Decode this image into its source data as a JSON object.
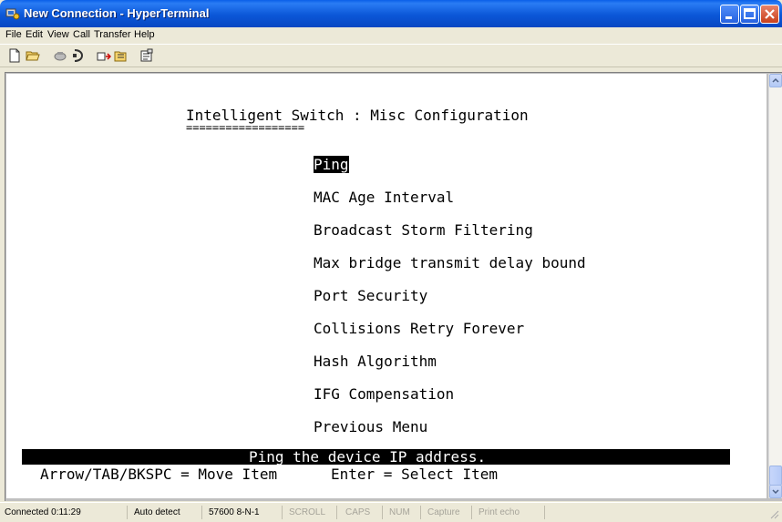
{
  "window": {
    "title": "New Connection - HyperTerminal",
    "buttons": [
      "minimize",
      "maximize",
      "close"
    ]
  },
  "menu": [
    "File",
    "Edit",
    "View",
    "Call",
    "Transfer",
    "Help"
  ],
  "toolbar": [
    "new-icon",
    "open-icon",
    "disconnect-icon",
    "dial-icon",
    "send-icon",
    "receive-icon",
    "properties-icon"
  ],
  "terminal": {
    "header": "Intelligent Switch : Misc Configuration",
    "underline": "==================",
    "items": [
      "Ping",
      "MAC Age Interval",
      "Broadcast Storm Filtering",
      "Max bridge transmit delay bound",
      "Port Security",
      "Collisions Retry Forever",
      "Hash Algorithm",
      "IFG Compensation",
      "Previous Menu"
    ],
    "selected_index": 0,
    "help_text": "Ping the device IP address.",
    "keys_left": "Arrow/TAB/BKSPC = Move Item",
    "keys_right": "Enter = Select Item"
  },
  "statusbar": {
    "connected": "Connected 0:11:29",
    "detect": "Auto detect",
    "port_settings": "57600 8-N-1",
    "scroll": "SCROLL",
    "caps": "CAPS",
    "num": "NUM",
    "capture": "Capture",
    "print_echo": "Print echo"
  }
}
